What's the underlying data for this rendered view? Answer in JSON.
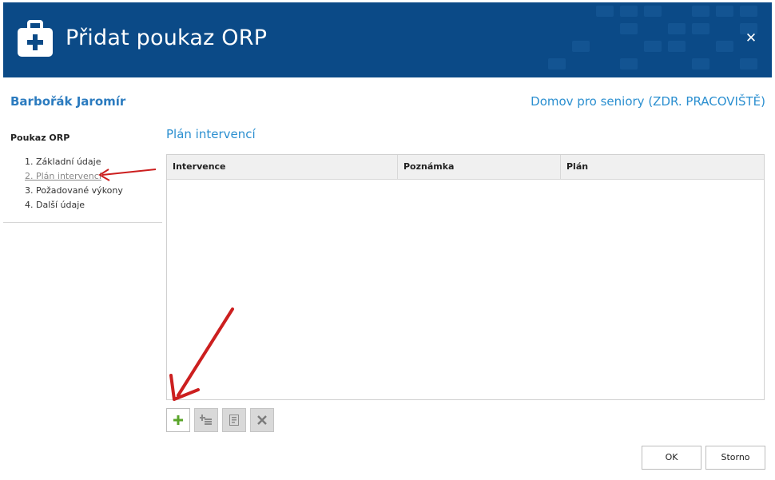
{
  "dialog": {
    "title": "Přidat poukaz ORP",
    "close_glyph": "✕",
    "title_icon": "medical-kit-icon",
    "header_color": "#0b4a87"
  },
  "header": {
    "patient_name": "Barbořák Jaromír",
    "facility": "Domov pro seniory (ZDR. PRACOVIŠTĚ)"
  },
  "sidebar": {
    "title": "Poukaz ORP",
    "steps": [
      {
        "label": "1. Základní údaje"
      },
      {
        "label": "2. Plán intervencí"
      },
      {
        "label": "3. Požadované výkony"
      },
      {
        "label": "4. Další údaje"
      }
    ]
  },
  "section": {
    "title": "Plán intervencí"
  },
  "grid": {
    "columns": [
      "Intervence",
      "Poznámka",
      "Plán"
    ],
    "rows": []
  },
  "toolbar": {
    "add": {
      "icon": "plus-icon",
      "enabled": true,
      "color": "#5aa52a"
    },
    "add_sub": {
      "icon": "add-sub-item-icon",
      "enabled": false
    },
    "edit": {
      "icon": "edit-document-icon",
      "enabled": false
    },
    "delete": {
      "icon": "delete-x-icon",
      "enabled": false
    }
  },
  "footer": {
    "ok_label": "OK",
    "cancel_label": "Storno"
  },
  "annotations": {
    "arrow_color": "#cc1f1f"
  }
}
